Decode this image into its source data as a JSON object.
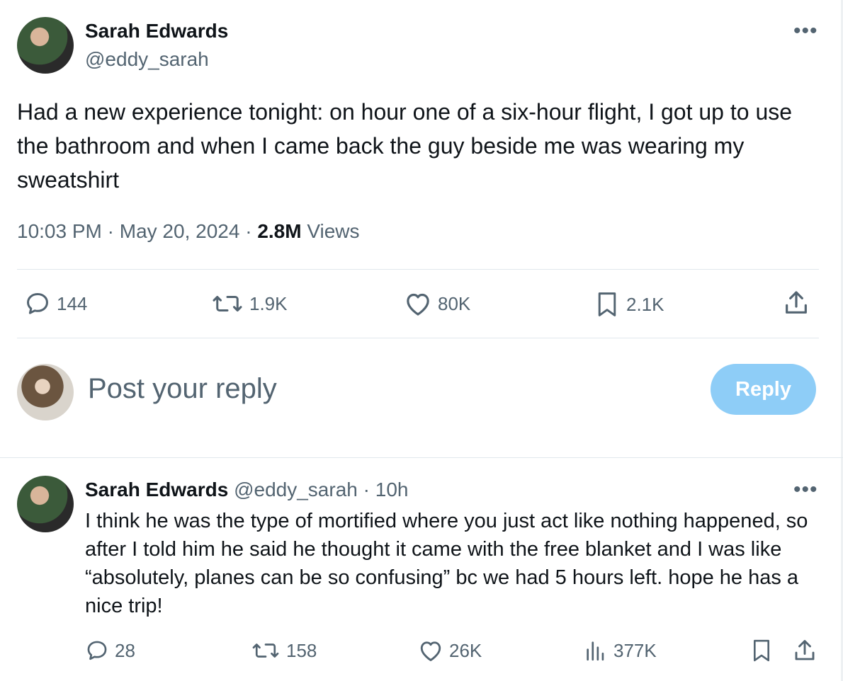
{
  "main_post": {
    "author_name": "Sarah Edwards",
    "author_handle": "@eddy_sarah",
    "text": "Had a new experience tonight: on hour one of a six-hour flight, I got up to use the bathroom and when I came back the guy beside me was wearing my sweatshirt",
    "time": "10:03 PM",
    "date": "May 20, 2024",
    "separator": "·",
    "views_count": "2.8M",
    "views_label": "Views",
    "more_icon": "ellipsis-icon",
    "actions": {
      "replies": "144",
      "reposts": "1.9K",
      "likes": "80K",
      "bookmarks": "2.1K"
    }
  },
  "composer": {
    "placeholder": "Post your reply",
    "button_label": "Reply",
    "button_color": "#8ecdf7"
  },
  "reply_post": {
    "author_name": "Sarah Edwards",
    "author_handle": "@eddy_sarah",
    "separator": "·",
    "time_ago": "10h",
    "text": "I think he was the type of mortified where you just act like nothing happened, so after I told him he said he thought it came with the free blanket and I was like “absolutely, planes can be so confusing” bc we had 5 hours left. hope he has a nice trip!",
    "actions": {
      "replies": "28",
      "reposts": "158",
      "likes": "26K",
      "views": "377K"
    }
  },
  "colors": {
    "text_primary": "#0f1419",
    "text_secondary": "#536471",
    "divider": "#e1e8ed",
    "accent": "#1d9bf0"
  }
}
